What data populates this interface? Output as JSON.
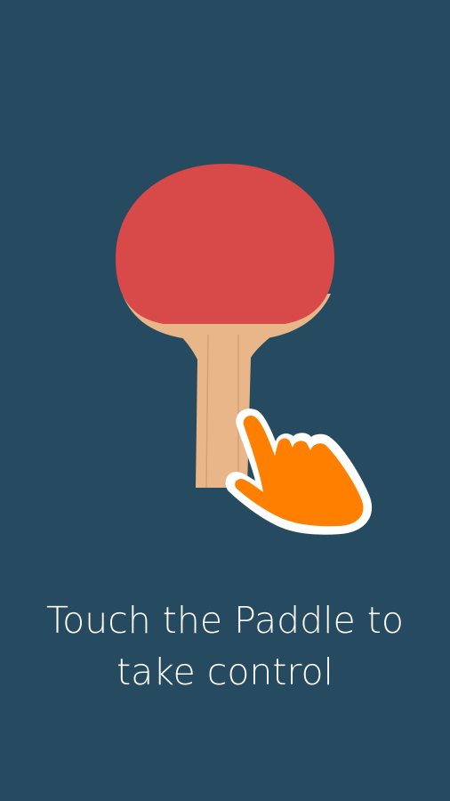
{
  "screen": {
    "background_color": "#264a60"
  },
  "illustration": {
    "paddle_rubber_color": "#d84949",
    "paddle_wood_color": "#e8b688",
    "hand_color": "#ff8000",
    "hand_outline_color": "#ffffff",
    "icons": [
      "ping-pong-paddle-icon",
      "pointing-hand-icon"
    ]
  },
  "instruction": {
    "line1": "Touch the Paddle to",
    "line2": "take control"
  }
}
